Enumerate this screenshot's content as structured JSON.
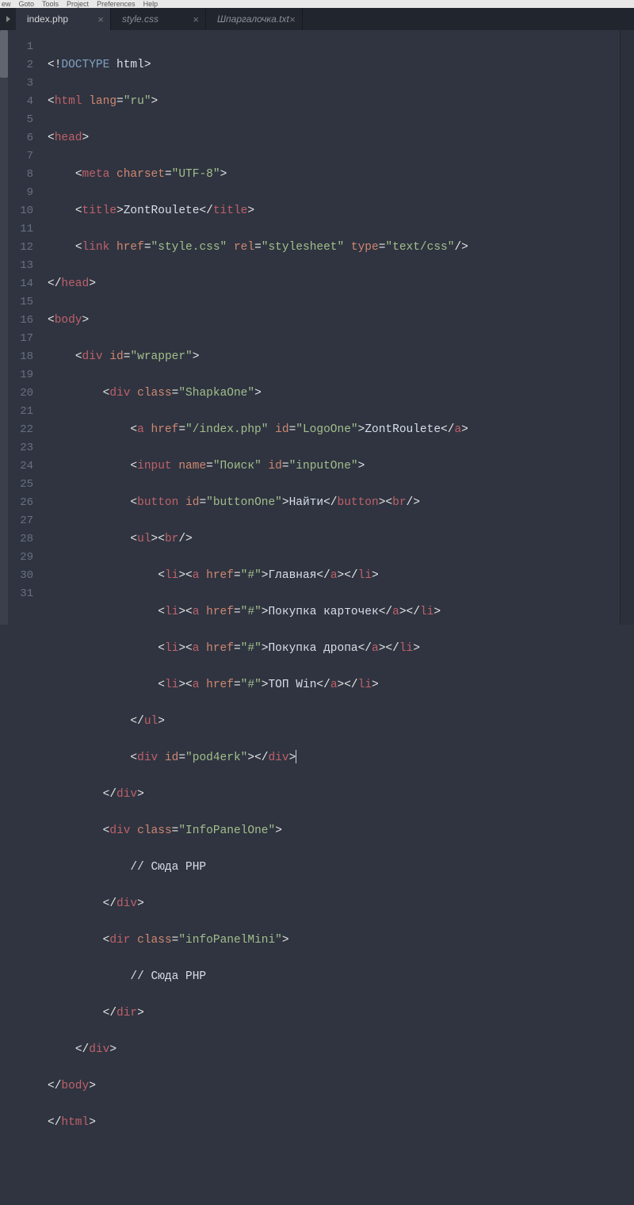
{
  "menubar": {
    "items": [
      "ew",
      "Goto",
      "Tools",
      "Project",
      "Preferences",
      "Help"
    ]
  },
  "tabs": [
    {
      "label": "index.php",
      "active": true
    },
    {
      "label": "style.css",
      "active": false
    },
    {
      "label": "Шпаргалочка.txt",
      "active": false
    }
  ],
  "line_count": 31,
  "code": {
    "l1": {
      "a": "<!",
      "b": "DOCTYPE",
      "c": " html",
      "d": ">"
    },
    "l2": {
      "a": "<",
      "b": "html",
      "c": " lang",
      "d": "=",
      "e": "\"ru\"",
      "f": ">"
    },
    "l3": {
      "a": "<",
      "b": "head",
      "c": ">"
    },
    "l4": {
      "ind": "    ",
      "a": "<",
      "b": "meta",
      "c": " charset",
      "d": "=",
      "e": "\"UTF-8\"",
      "f": ">"
    },
    "l5": {
      "ind": "    ",
      "a": "<",
      "b": "title",
      "c": ">",
      "d": "ZontRoulete",
      "e": "</",
      "f": "title",
      "g": ">"
    },
    "l6": {
      "ind": "    ",
      "a": "<",
      "b": "link",
      "c": " href",
      "d": "=",
      "e": "\"style.css\"",
      "f": " rel",
      "g": "=",
      "h": "\"stylesheet\"",
      "i": " type",
      "j": "=",
      "k": "\"text/css\"",
      "l": "/>"
    },
    "l7": {
      "a": "</",
      "b": "head",
      "c": ">"
    },
    "l8": {
      "a": "<",
      "b": "body",
      "c": ">"
    },
    "l9": {
      "ind": "    ",
      "a": "<",
      "b": "div",
      "c": " id",
      "d": "=",
      "e": "\"wrapper\"",
      "f": ">"
    },
    "l10": {
      "ind": "        ",
      "a": "<",
      "b": "div",
      "c": " class",
      "d": "=",
      "e": "\"ShapkaOne\"",
      "f": ">"
    },
    "l11": {
      "ind": "            ",
      "a": "<",
      "b": "a",
      "c": " href",
      "d": "=",
      "e": "\"/index.php\"",
      "f": " id",
      "g": "=",
      "h": "\"LogoOne\"",
      "i": ">",
      "j": "ZontRoulete",
      "k": "</",
      "l": "a",
      "m": ">"
    },
    "l12": {
      "ind": "            ",
      "a": "<",
      "b": "input",
      "c": " name",
      "d": "=",
      "e": "\"Поиск\"",
      "f": " id",
      "g": "=",
      "h": "\"inputOne\"",
      "i": ">"
    },
    "l13": {
      "ind": "            ",
      "a": "<",
      "b": "button",
      "c": " id",
      "d": "=",
      "e": "\"buttonOne\"",
      "f": ">",
      "g": "Найти",
      "h": "</",
      "i": "button",
      "j": "><",
      "k": "br",
      "l": "/>"
    },
    "l14": {
      "ind": "            ",
      "a": "<",
      "b": "ul",
      "c": "><",
      "d": "br",
      "e": "/>"
    },
    "l15": {
      "ind": "                ",
      "a": "<",
      "b": "li",
      "c": "><",
      "d": "a",
      "e": " href",
      "f": "=",
      "g": "\"#\"",
      "h": ">",
      "i": "Главная",
      "j": "</",
      "k": "a",
      "l": "></",
      "m": "li",
      "n": ">"
    },
    "l16": {
      "ind": "                ",
      "a": "<",
      "b": "li",
      "c": "><",
      "d": "a",
      "e": " href",
      "f": "=",
      "g": "\"#\"",
      "h": ">",
      "i": "Покупка карточек",
      "j": "</",
      "k": "a",
      "l": "></",
      "m": "li",
      "n": ">"
    },
    "l17": {
      "ind": "                ",
      "a": "<",
      "b": "li",
      "c": "><",
      "d": "a",
      "e": " href",
      "f": "=",
      "g": "\"#\"",
      "h": ">",
      "i": "Покупка дропа",
      "j": "</",
      "k": "a",
      "l": "></",
      "m": "li",
      "n": ">"
    },
    "l18": {
      "ind": "                ",
      "a": "<",
      "b": "li",
      "c": "><",
      "d": "a",
      "e": " href",
      "f": "=",
      "g": "\"#\"",
      "h": ">",
      "i": "ТОП Win",
      "j": "</",
      "k": "a",
      "l": "></",
      "m": "li",
      "n": ">"
    },
    "l19": {
      "ind": "            ",
      "a": "</",
      "b": "ul",
      "c": ">"
    },
    "l20": {
      "ind": "            ",
      "a": "<",
      "b": "div",
      "c": " id",
      "d": "=",
      "e": "\"pod4erk\"",
      "f": "></",
      "g": "div",
      "h": ">"
    },
    "l21": {
      "ind": "        ",
      "a": "</",
      "b": "div",
      "c": ">"
    },
    "l22": {
      "ind": "        ",
      "a": "<",
      "b": "div",
      "c": " class",
      "d": "=",
      "e": "\"InfoPanelOne\"",
      "f": ">"
    },
    "l23": {
      "ind": "            ",
      "a": "// Сюда PHP"
    },
    "l24": {
      "ind": "        ",
      "a": "</",
      "b": "div",
      "c": ">"
    },
    "l25": {
      "ind": "        ",
      "a": "<",
      "b": "dir",
      "c": " class",
      "d": "=",
      "e": "\"infoPanelMini\"",
      "f": ">"
    },
    "l26": {
      "ind": "            ",
      "a": "// Сюда PHP"
    },
    "l27": {
      "ind": "        ",
      "a": "</",
      "b": "dir",
      "c": ">"
    },
    "l28": {
      "ind": "    ",
      "a": "</",
      "b": "div",
      "c": ">"
    },
    "l29": {
      "a": "</",
      "b": "body",
      "c": ">"
    },
    "l30": {
      "a": "</",
      "b": "html",
      "c": ">"
    }
  }
}
